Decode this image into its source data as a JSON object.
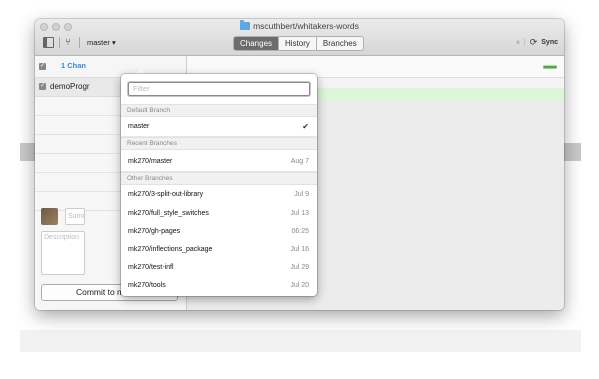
{
  "window": {
    "title": "mscuthbert/whitakers-words",
    "branch": "master ▾",
    "tabs": [
      {
        "label": "Changes",
        "active": true
      },
      {
        "label": "History",
        "active": false
      },
      {
        "label": "Branches",
        "active": false
      }
    ],
    "sync_label": "Sync"
  },
  "sidebar": {
    "changes_label": "1 Chan",
    "file_name": "demoProgr",
    "summary_placeholder": "Summ",
    "description_placeholder": "Description",
    "commit_button": "Commit to master"
  },
  "main": {
    "hunk_text": "@@",
    "added_line": "o"
  },
  "dropdown": {
    "filter_placeholder": "Filter",
    "default_section": "Default Branch",
    "default_item": {
      "name": "master",
      "checked": true
    },
    "recent_section": "Recent Branches",
    "recent_items": [
      {
        "name": "mk270/master",
        "date": "Aug 7"
      }
    ],
    "other_section": "Other Branches",
    "other_items": [
      {
        "name": "mk270/3-split-out-library",
        "date": "Jul 9"
      },
      {
        "name": "mk270/full_style_switches",
        "date": "Jul 13"
      },
      {
        "name": "mk270/gh-pages",
        "date": "06:25"
      },
      {
        "name": "mk270/inflections_package",
        "date": "Jul 16"
      },
      {
        "name": "mk270/test-infl",
        "date": "Jul 29"
      },
      {
        "name": "mk270/tools",
        "date": "Jul 20"
      }
    ]
  },
  "colors": {
    "accent_blue": "#3a8ad9",
    "active_tab": "#6c6c6c",
    "added_line_bg": "#dbf7d6"
  },
  "icons": [
    "folder-icon",
    "sidebar-toggle-icon",
    "branch-icon",
    "pause-icon",
    "sync-icon",
    "checkbox-icon",
    "checkmark-icon"
  ]
}
